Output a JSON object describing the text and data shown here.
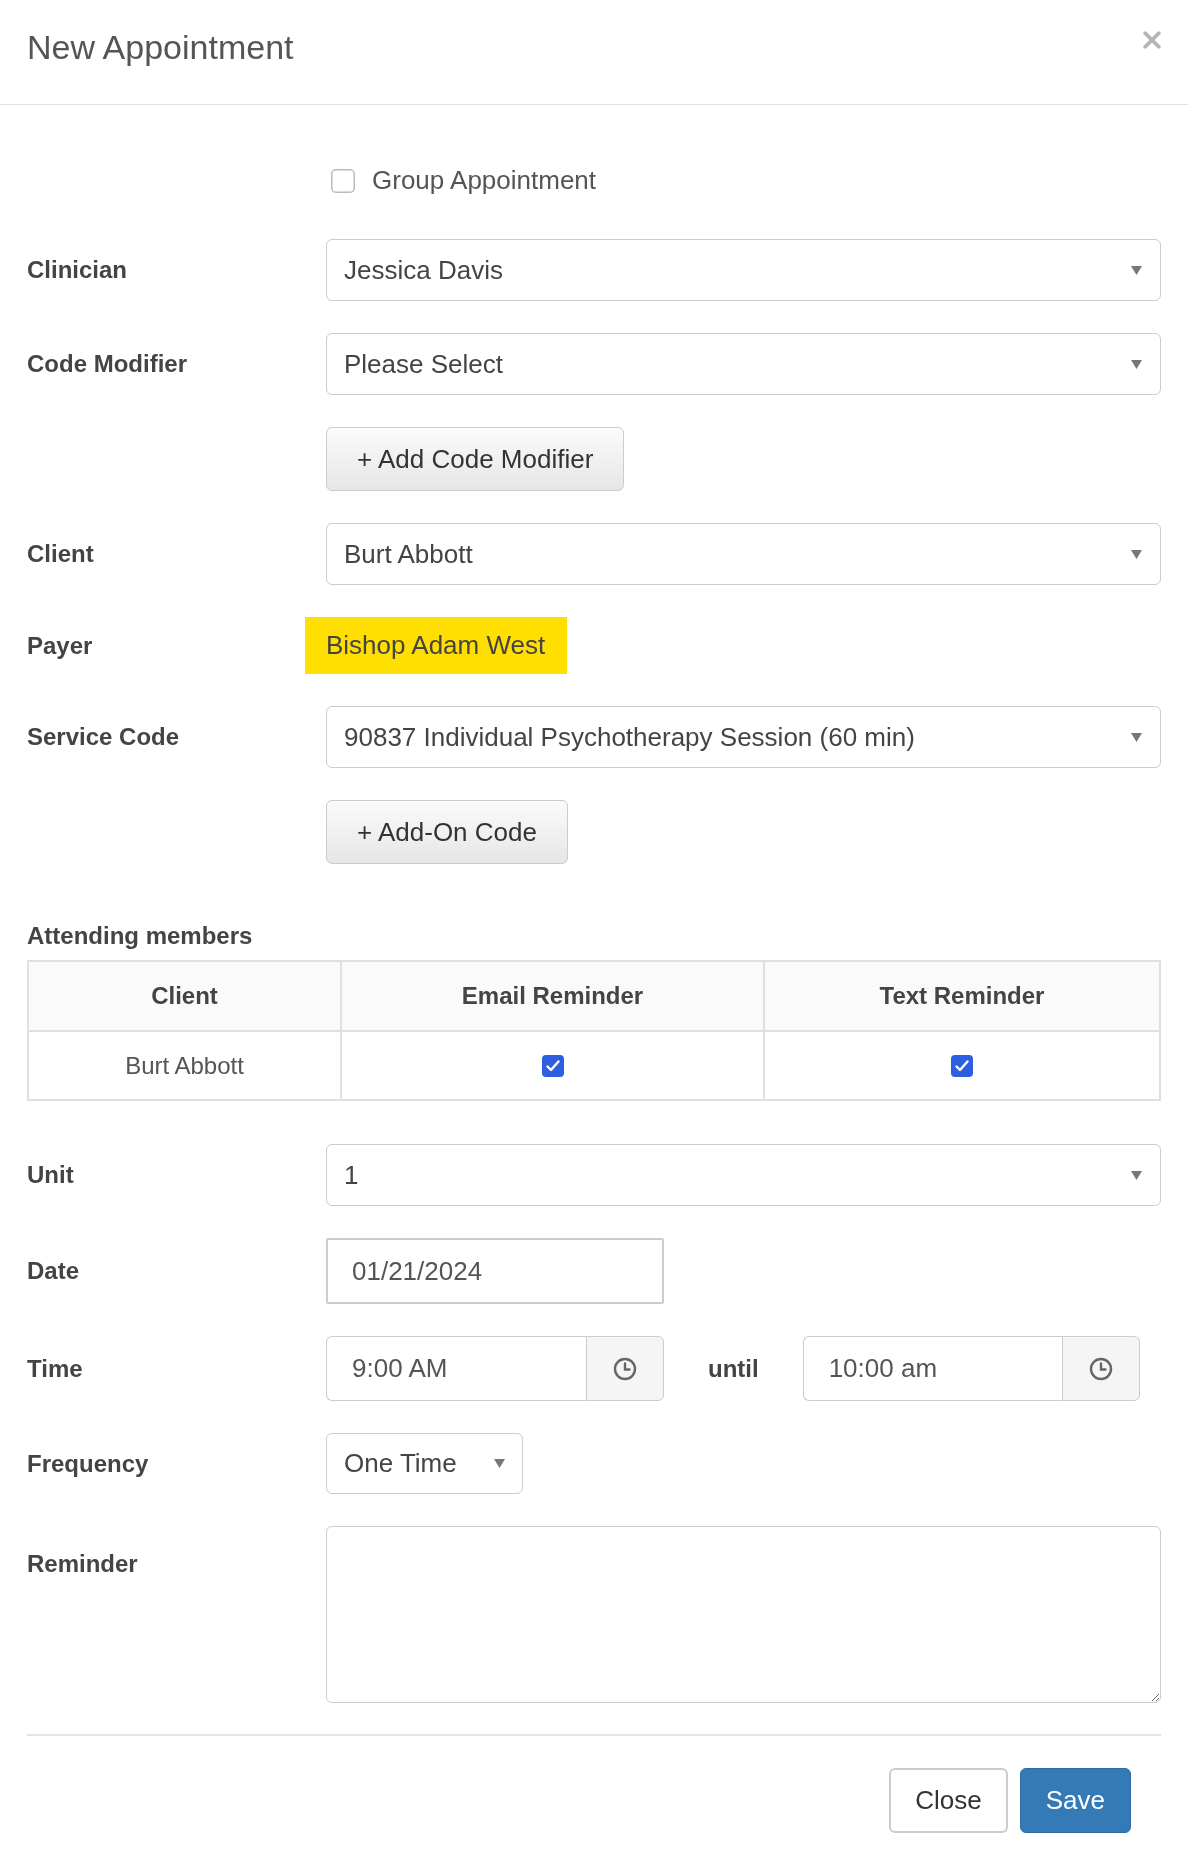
{
  "dialog": {
    "title": "New Appointment"
  },
  "group_appointment": {
    "label": "Group Appointment",
    "checked": false
  },
  "fields": [
    {
      "kind": "select",
      "label": "Clinician",
      "value": "Jessica Davis"
    },
    {
      "kind": "select",
      "label": "Code Modifier",
      "value": "Please Select"
    },
    {
      "kind": "button",
      "text": "+ Add Code Modifier"
    },
    {
      "kind": "select",
      "label": "Client",
      "value": "Burt Abbott"
    },
    {
      "kind": "highlight",
      "label": "Payer",
      "value": "Bishop Adam West"
    },
    {
      "kind": "select",
      "label": "Service Code",
      "value": "90837 Individual Psychotherapy Session (60 min)"
    },
    {
      "kind": "button",
      "text": "+ Add-On Code"
    }
  ],
  "attending_members": {
    "title": "Attending members",
    "columns": [
      "Client",
      "Email Reminder",
      "Text Reminder"
    ],
    "rows": [
      {
        "client": "Burt Abbott",
        "email_reminder": true,
        "text_reminder": true
      }
    ]
  },
  "schedule_fields": [
    {
      "kind": "select",
      "label": "Unit",
      "value": "1"
    },
    {
      "kind": "date",
      "label": "Date",
      "value": "01/21/2024"
    },
    {
      "kind": "time_range",
      "label": "Time",
      "start": "9:00 AM",
      "separator": "until",
      "end": "10:00 am"
    },
    {
      "kind": "dropdown",
      "label": "Frequency",
      "value": "One Time"
    },
    {
      "kind": "textarea",
      "label": "Reminder"
    }
  ],
  "footer": {
    "buttons": [
      {
        "label": "Close",
        "kind": "default"
      },
      {
        "label": "Save",
        "kind": "primary"
      }
    ]
  }
}
